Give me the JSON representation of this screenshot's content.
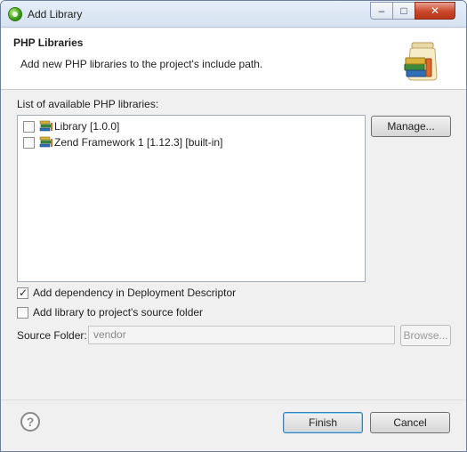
{
  "window": {
    "title": "Add Library"
  },
  "header": {
    "title": "PHP Libraries",
    "description": "Add new PHP libraries to the project's include path."
  },
  "libraries": {
    "label": "List of available PHP libraries:",
    "items": [
      {
        "label": "Library [1.0.0]",
        "checked": false
      },
      {
        "label": "Zend Framework 1 [1.12.3] [built-in]",
        "checked": false
      }
    ],
    "manage_label": "Manage..."
  },
  "options": {
    "add_dependency": {
      "label": "Add dependency in Deployment Descriptor",
      "checked": true
    },
    "add_to_source": {
      "label": "Add library to project's source folder",
      "checked": false
    }
  },
  "source_folder": {
    "label": "Source Folder:",
    "value": "vendor",
    "browse_label": "Browse..."
  },
  "footer": {
    "finish_label": "Finish",
    "cancel_label": "Cancel"
  },
  "icons": {
    "app": "eclipse-app-icon",
    "help": "help-icon",
    "library": "library-books-icon",
    "banner": "library-jar-icon"
  }
}
